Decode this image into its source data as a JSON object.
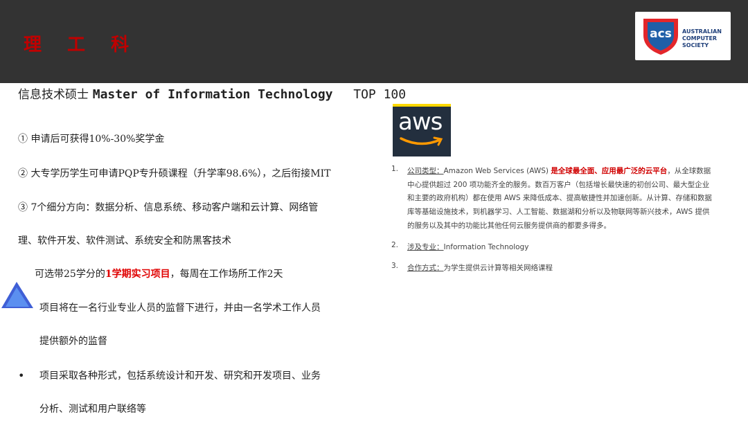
{
  "header": {
    "title": "理 工 科",
    "logo": {
      "abbr": "acs",
      "line1": "AUSTRALIAN",
      "line2": "COMPUTER",
      "line3": "SOCIETY"
    },
    "colors": {
      "bar": "#333333",
      "title": "#c00000"
    }
  },
  "main": {
    "title_cn": "信息技术硕士",
    "title_en": "Master of Information Technology",
    "rank": "TOP 100",
    "lines": [
      "① 申请后可获得10%-30%奖学金",
      "② 大专学历学生可申请PQP专升硕课程（升学率98.6%），之后衔接MIT",
      "③ 7个细分方向：数据分析、信息系统、移动客户端和云计算、网络管",
      "理、软件开发、软件测试、系统安全和防黑客技术"
    ],
    "intern": {
      "prefix": "可选带25学分的",
      "highlight": "1学期实习项目",
      "suffix": "，每周在工作场所工作2天"
    },
    "bullet1_line1": "项目将在一名行业专业人员的监督下进行，并由一名学术工作人员",
    "bullet1_line2": "提供额外的监督",
    "bullet2_line1": "项目采取各种形式，包括系统设计和开发、研究和开发项目、业务",
    "bullet2_line2": "分析、测试和用户联络等",
    "bullet_char": "•"
  },
  "aws": {
    "logo_text": "aws",
    "items": [
      {
        "num": "1.",
        "label": "公司类型：",
        "text_before": "Amazon Web Services (AWS) ",
        "highlight": "是全球最全面、应用最广泛的云平台",
        "text_after": "，从全球数据中心提供超过 200 项功能齐全的服务。数百万客户（包括增长最快速的初创公司、最大型企业和主要的政府机构）都在使用 AWS 来降低成本、提高敏捷性并加速创新。从计算、存储和数据库等基础设施技术，到机器学习、人工智能、数据湖和分析以及物联网等新兴技术，AWS 提供的服务以及其中的功能比其他任何云服务提供商的都要多得多。"
      },
      {
        "num": "2.",
        "label": "涉及专业：",
        "text": "Information Technology"
      },
      {
        "num": "3.",
        "label": "合作方式：",
        "text": "为学生提供云计算等相关网络课程"
      }
    ]
  }
}
